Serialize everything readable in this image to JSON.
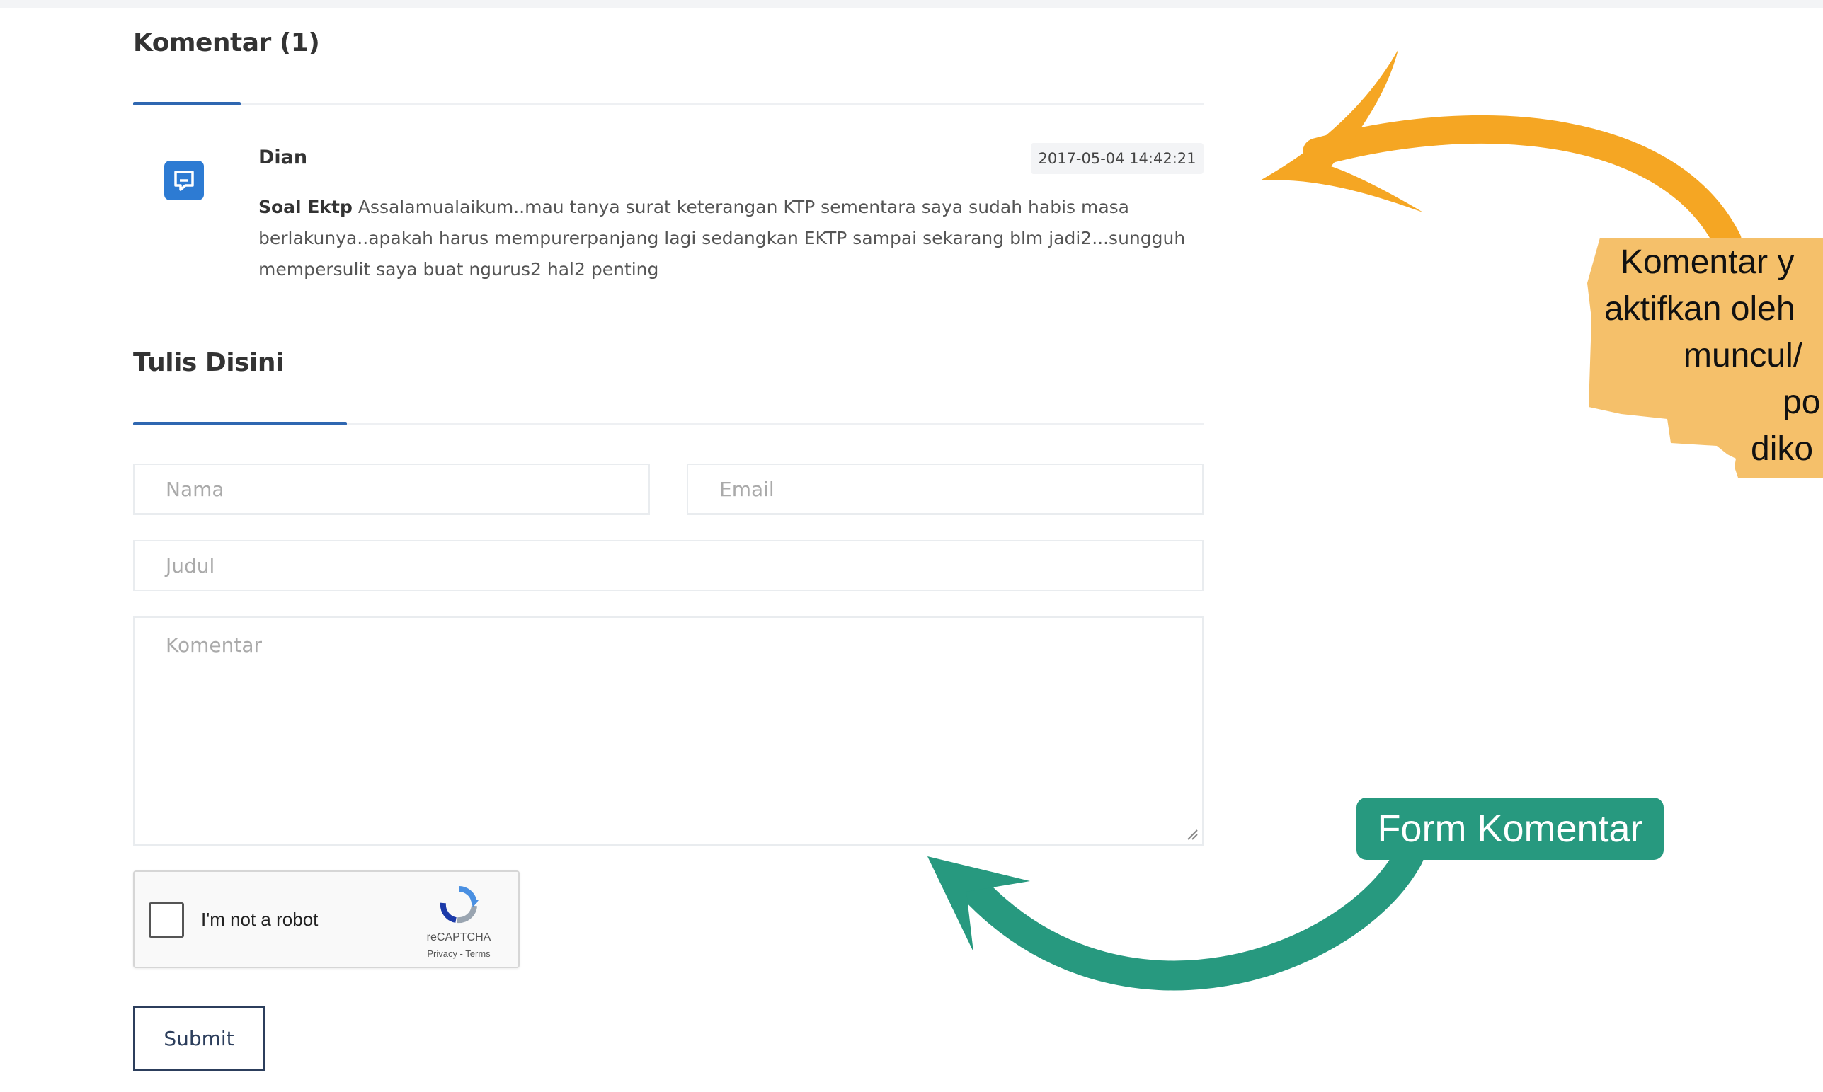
{
  "comments_section": {
    "title": "Komentar (1)"
  },
  "comment": {
    "author": "Dian",
    "date": "2017-05-04 14:42:21",
    "subject": "Soal Ektp",
    "text": "Assalamualaikum..mau tanya surat keterangan KTP sementara saya sudah habis masa berlakunya..apakah harus mempurerpanjang lagi sedangkan EKTP sampai sekarang blm jadi2...sungguh mempersulit saya buat ngurus2 hal2 penting",
    "avatar_icon": "comment-icon"
  },
  "form": {
    "title": "Tulis Disini",
    "name_placeholder": "Nama",
    "email_placeholder": "Email",
    "subject_placeholder": "Judul",
    "comment_placeholder": "Komentar",
    "submit_label": "Submit"
  },
  "recaptcha": {
    "label": "I'm not a robot",
    "brand": "reCAPTCHA",
    "links": "Privacy - Terms"
  },
  "annotations": {
    "orange_note_lines": [
      "Komentar y",
      "aktifkan oleh",
      "muncul/",
      "po",
      "diko"
    ],
    "teal_label": "Form Komentar",
    "orange_color": "#f5a623",
    "teal_color": "#27997f"
  },
  "colors": {
    "accent": "#2f67b1",
    "avatar_bg": "#2d7bd3"
  }
}
